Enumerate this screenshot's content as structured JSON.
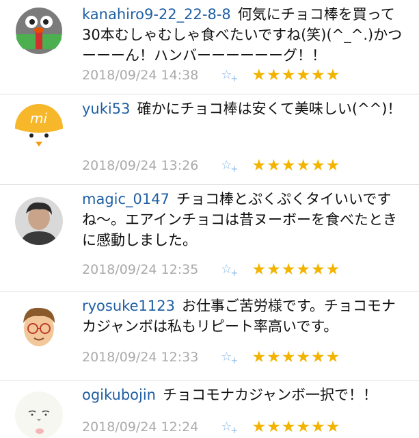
{
  "comments": [
    {
      "user": "kanahiro9-22_22-8-8",
      "text": "何気にチョコ棒を買って30本むしゃむしゃ食べたいですね(笑)(^_^.)かつーーーん！ハンバーーーーーーグ！！",
      "timestamp": "2018/09/24 14:38",
      "favorite_icon": "star-plus-icon",
      "rating": "★★★★★★"
    },
    {
      "user": "yuki53",
      "text": "確かにチョコ棒は安くて美味しい(^^)！",
      "timestamp": "2018/09/24 13:26",
      "favorite_icon": "star-plus-icon",
      "rating": "★★★★★★"
    },
    {
      "user": "magic_0147",
      "text": "チョコ棒とぷくぷくタイいいですね〜。エアインチョコは昔ヌーボーを食べたときに感動しました。",
      "timestamp": "2018/09/24 12:35",
      "favorite_icon": "star-plus-icon",
      "rating": "★★★★★★"
    },
    {
      "user": "ryosuke1123",
      "text": "お仕事ご苦労様です。チョコモナカジャンボは私もリピート率高いです。",
      "timestamp": "2018/09/24 12:33",
      "favorite_icon": "star-plus-icon",
      "rating": "★★★★★★"
    },
    {
      "user": "ogikubojin",
      "text": "チョコモナカジャンボ一択で！！",
      "timestamp": "2018/09/24 12:24",
      "favorite_icon": "star-plus-icon",
      "rating": "★★★★★★"
    }
  ],
  "colors": {
    "username": "#1f5fa3",
    "timestamp": "#aaaaaa",
    "star": "#f2b400",
    "favorite": "#8ab6e6"
  }
}
